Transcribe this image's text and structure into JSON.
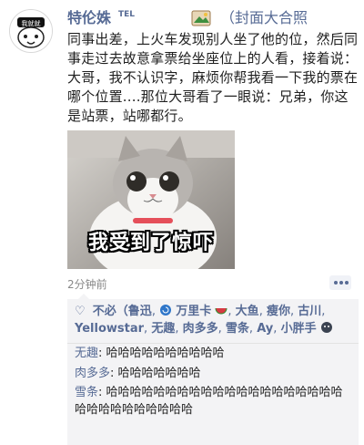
{
  "post": {
    "author": "特伦姝",
    "author_tag": "TEL",
    "title_note": "（封面大合照",
    "text": "同事出差，上火车发现别人坐了他的位，然后同事走过去故意拿票给坐座位上的人看，接着说：大哥，我不认识字，麻烦你帮我看一下我的票在哪个位置....那位大哥看了一眼说：兄弟，你这是站票，站哪都行。",
    "avatar_text": "我就就",
    "image_caption": "我受到了惊吓",
    "time": "2分钟前",
    "more_icon": "ellipsis-icon"
  },
  "likes": {
    "heart_icon": "heart-outline-icon",
    "items": [
      "不必（鲁迅",
      "万里卡",
      "大鱼",
      "瘦你",
      "古川",
      "Yellowstar",
      "无趣",
      "肉多多",
      "雪条",
      "Ay",
      "小胖手"
    ]
  },
  "comments": [
    {
      "author": "无趣",
      "text": "哈哈哈哈哈哈哈哈哈哈"
    },
    {
      "author": "肉多多",
      "text": "哈哈哈哈哈哈哈"
    },
    {
      "author": "雪条",
      "text": "哈哈哈哈哈哈哈哈哈哈哈哈哈哈哈哈哈哈哈哈哈哈哈哈哈哈哈哈哈哈"
    }
  ],
  "colors": {
    "link": "#576b95",
    "comment_bg": "#f3f3f5"
  }
}
